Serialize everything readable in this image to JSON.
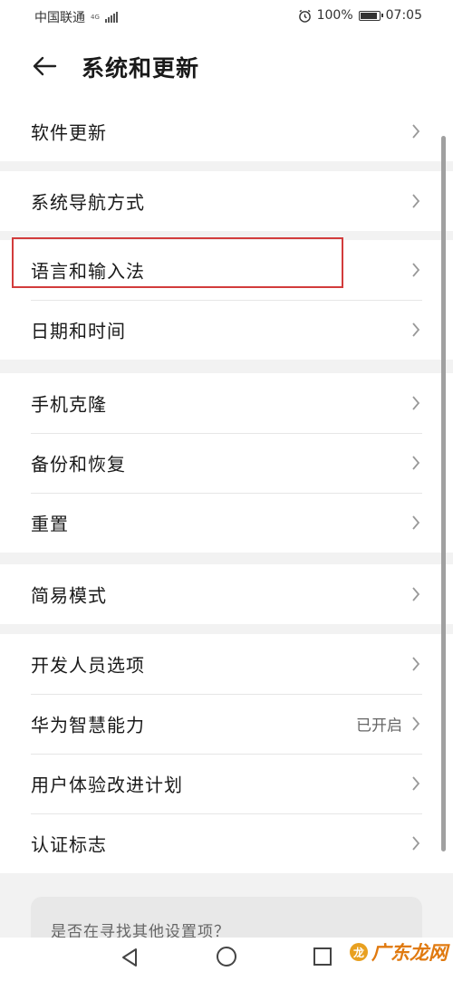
{
  "status_bar": {
    "carrier": "中国联通",
    "network_type": "4G",
    "battery_percent": "100%",
    "battery_level": 1.0,
    "time": "07:05"
  },
  "header": {
    "title": "系统和更新"
  },
  "settings_groups": [
    {
      "items": [
        {
          "label": "软件更新"
        }
      ]
    },
    {
      "items": [
        {
          "label": "系统导航方式"
        },
        {
          "label": "语言和输入法"
        },
        {
          "label": "日期和时间"
        }
      ]
    },
    {
      "items": [
        {
          "label": "手机克隆"
        },
        {
          "label": "备份和恢复"
        },
        {
          "label": "重置"
        }
      ]
    },
    {
      "items": [
        {
          "label": "简易模式"
        }
      ]
    },
    {
      "items": [
        {
          "label": "开发人员选项"
        },
        {
          "label": "华为智慧能力",
          "value": "已开启"
        },
        {
          "label": "用户体验改进计划"
        },
        {
          "label": "认证标志"
        }
      ]
    }
  ],
  "suggestion": {
    "text": "是否在寻找其他设置项？"
  },
  "annotation": {
    "highlight_color": "#d23c3c"
  },
  "watermark": {
    "text": "广东龙网"
  },
  "icons": [
    "back-arrow-icon",
    "chevron-right-icon",
    "alarm-icon",
    "battery-icon",
    "signal-icon",
    "nav-back-icon",
    "nav-home-icon",
    "nav-recent-icon"
  ]
}
